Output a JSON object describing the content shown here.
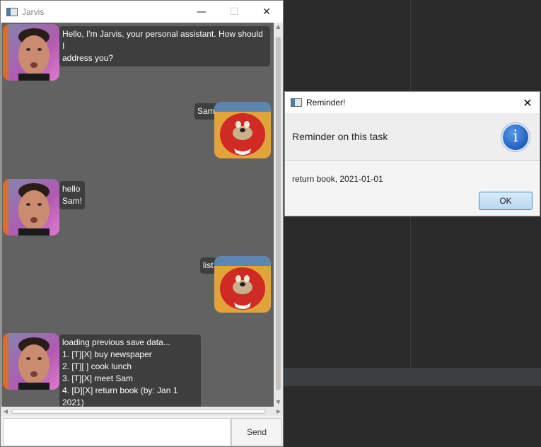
{
  "main_window": {
    "title": "Jarvis",
    "controls": {
      "minimize": "—",
      "maximize": "☐",
      "close": "✕"
    }
  },
  "messages": [
    {
      "sender": "jarvis",
      "avatar": "elon-avatar",
      "text": "Hello, I'm Jarvis, your personal assistant. How should I\naddress you?"
    },
    {
      "sender": "user",
      "avatar": "knuckles-avatar",
      "text": "Sam"
    },
    {
      "sender": "jarvis",
      "avatar": "elon-avatar",
      "text": "hello Sam!"
    },
    {
      "sender": "user",
      "avatar": "knuckles-avatar",
      "text": "list"
    },
    {
      "sender": "jarvis",
      "avatar": "elon-avatar",
      "text": "loading previous save data...\n1. [T][X] buy newspaper\n2. [T][ ] cook lunch\n3. [T][X] meet Sam\n4. [D][X] return book (by: Jan 1 2021)"
    }
  ],
  "input": {
    "value": "",
    "placeholder": ""
  },
  "send_button": {
    "label": "Send"
  },
  "dialog": {
    "title": "Reminder!",
    "close": "✕",
    "header": "Reminder on this task",
    "icon": "info-icon",
    "icon_glyph": "i",
    "message": "return book, 2021-01-01",
    "ok_label": "OK"
  }
}
